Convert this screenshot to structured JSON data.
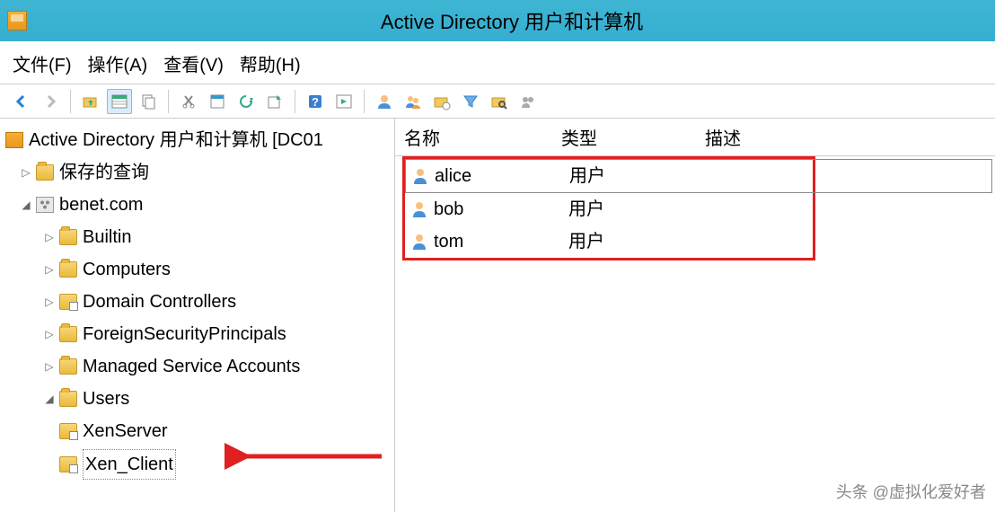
{
  "window": {
    "title": "Active Directory 用户和计算机"
  },
  "menubar": {
    "file": "文件(F)",
    "action": "操作(A)",
    "view": "查看(V)",
    "help": "帮助(H)"
  },
  "tree": {
    "root": "Active Directory 用户和计算机 [DC01",
    "saved_queries": "保存的查询",
    "domain": "benet.com",
    "builtin": "Builtin",
    "computers": "Computers",
    "domain_controllers": "Domain Controllers",
    "foreign_security_principals": "ForeignSecurityPrincipals",
    "managed_service_accounts": "Managed Service Accounts",
    "users": "Users",
    "xen_server": "XenServer",
    "xen_client": "Xen_Client"
  },
  "list": {
    "headers": {
      "name": "名称",
      "type": "类型",
      "description": "描述"
    },
    "rows": [
      {
        "name": "alice",
        "type": "用户"
      },
      {
        "name": "bob",
        "type": "用户"
      },
      {
        "name": "tom",
        "type": "用户"
      }
    ]
  },
  "watermark": "头条 @虚拟化爱好者"
}
